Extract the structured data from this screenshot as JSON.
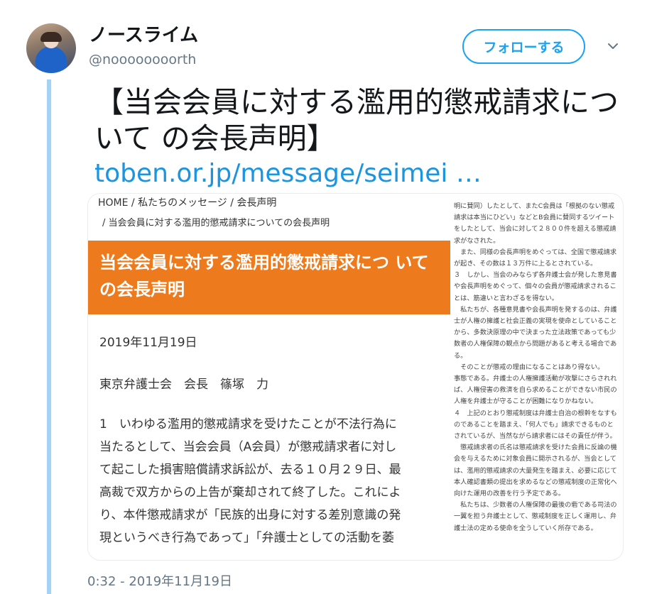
{
  "user": {
    "display_name": "ノースライム",
    "handle": "@noooooooorth"
  },
  "follow_button_label": "フォローする",
  "tweet": {
    "text": "【当会会員に対する濫用的懲戒請求について の会長声明】",
    "link": "toben.or.jp/message/seimei …",
    "timestamp": "0:32 - 2019年11月19日"
  },
  "image": {
    "breadcrumb_home": "HOME / 私たちのメッセージ / 会長声明",
    "breadcrumb_current": "/ 当会会員に対する濫用的懲戒請求についての会長声明",
    "banner_title": "当会会員に対する濫用的懲戒請求につ いての会長声明",
    "date": "2019年11月19日",
    "author": "東京弁護士会　会長　篠塚　力",
    "body_lines": [
      "1　いわゆる濫用的懲戒請求を受けたことが不法行為に",
      "当たるとして、当会会員（A会員）が懲戒請求者に対し",
      "て起こした損害賠償請求訴訟が、去る１０月２９日、最",
      "高裁で双方からの上告が棄却されて終了した。これによ",
      "り、本件懲戒請求が「民族的出身に対する差別意識の発",
      "現というべき行為であって」「弁護士としての活動を萎"
    ],
    "right_column_lines": [
      "明に賛同）したとして、またC会員は「根拠のない懲戒",
      "請求は本当にひどい」などとB会員に賛同するツイート",
      "をしたとして、当会に対して２８００件を超える懲戒請",
      "求がなされた。",
      "　また、同様の会長声明をめぐっては、全国で懲戒請求",
      "が起き、その数は１３万件に上るとされている。",
      "３　しかし、当会のみならず各弁護士会が発した意見書",
      "や会長声明をめぐって、個々の会員が懲戒請求されるこ",
      "とは、筋違いと言わざるを得ない。",
      "　私たちが、各種意見書や会長声明を発するのは、弁護",
      "士が人権の擁護と社会正義の実現を使命としていること",
      "から、多数決原理の中で決まった立法政策であっても少",
      "数者の人権保障の観点から問題があると考える場合であ",
      "る。",
      "　そのことが懲戒の理由になることはあり得ない。",
      "事態である。弁護士の人権擁護活動が攻撃にさらされれ",
      "ば、人権侵害の救済を自ら求めることができない市民の",
      "人権を弁護士が守ることが困難になりかねない。",
      "４　上記のとおり懲戒制度は弁護士自治の根幹をなすも",
      "のであることを踏まえ、「何人でも」請求できるものと",
      "されているが、当然ながら請求者にはその責任が伴う。",
      "　懲戒請求者の氏名は懲戒請求を受けた会員に反論の機",
      "会を与えるために対象会員に開示されるが、当会として",
      "は、濫用的懲戒請求の大量発生を踏まえ、必要に応じて",
      "本人確認書類の提出を求めるなどの懲戒制度の正常化へ",
      "向けた運用の改善を行う予定である。",
      "　私たちは、少数者の人権保障の最後の砦である司法の",
      "一翼を担う弁護士として、懲戒制度を正しく運用し、弁",
      "護士法の定める使命を全うしていく所存である。"
    ]
  },
  "colors": {
    "accent": "#1da1f2",
    "link": "#1b95e0",
    "thread_line": "#a3d3f2",
    "banner": "#ee7a1e",
    "secondary_text": "#657786"
  },
  "icons": [
    "chevron-down-icon"
  ]
}
